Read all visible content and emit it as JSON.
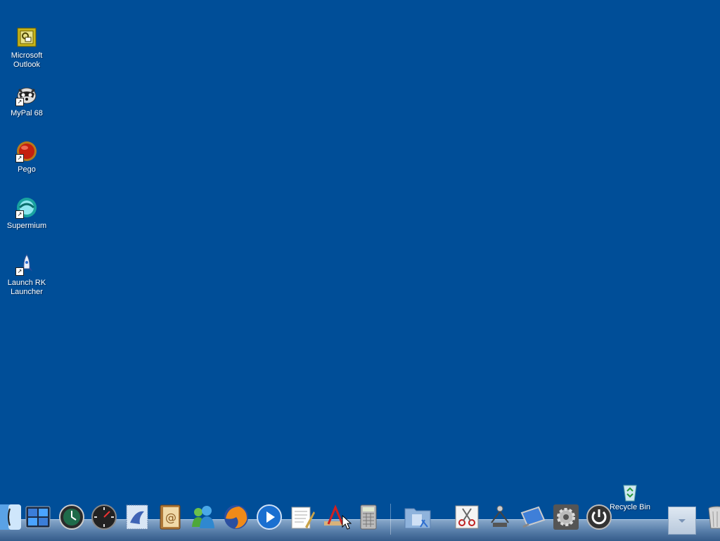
{
  "desktop": {
    "background_color": "#004e98",
    "icons": [
      {
        "label_line1": "Microsoft",
        "label_line2": "Outlook",
        "icon": "outlook-icon",
        "shortcut": false
      },
      {
        "label_line1": "MyPal 68",
        "label_line2": "",
        "icon": "mypal-raccoon-icon",
        "shortcut": true
      },
      {
        "label_line1": "Pego",
        "label_line2": "",
        "icon": "pego-red-orb-icon",
        "shortcut": true
      },
      {
        "label_line1": "Supermium",
        "label_line2": "",
        "icon": "supermium-globe-icon",
        "shortcut": true
      },
      {
        "label_line1": "Launch RK",
        "label_line2": "Launcher",
        "icon": "rocket-icon",
        "shortcut": true
      }
    ]
  },
  "dock": {
    "items": [
      {
        "name": "finder-icon"
      },
      {
        "name": "dashboard-icon"
      },
      {
        "name": "time-machine-icon"
      },
      {
        "name": "clock-dial-icon"
      },
      {
        "name": "mail-stamp-icon"
      },
      {
        "name": "address-book-icon"
      },
      {
        "name": "messenger-buddies-icon"
      },
      {
        "name": "firefox-icon"
      },
      {
        "name": "media-player-icon"
      },
      {
        "name": "textedit-icon"
      },
      {
        "name": "app-store-pencil-icon"
      },
      {
        "name": "calculator-icon"
      },
      {
        "name": "applications-folder-icon"
      },
      {
        "name": "scissors-icon"
      },
      {
        "name": "network-icon"
      },
      {
        "name": "display-icon"
      },
      {
        "name": "system-preferences-gear-icon"
      },
      {
        "name": "power-icon"
      },
      {
        "name": "trash-icon"
      }
    ],
    "recycle_bin_label": "Recycle Bin"
  }
}
